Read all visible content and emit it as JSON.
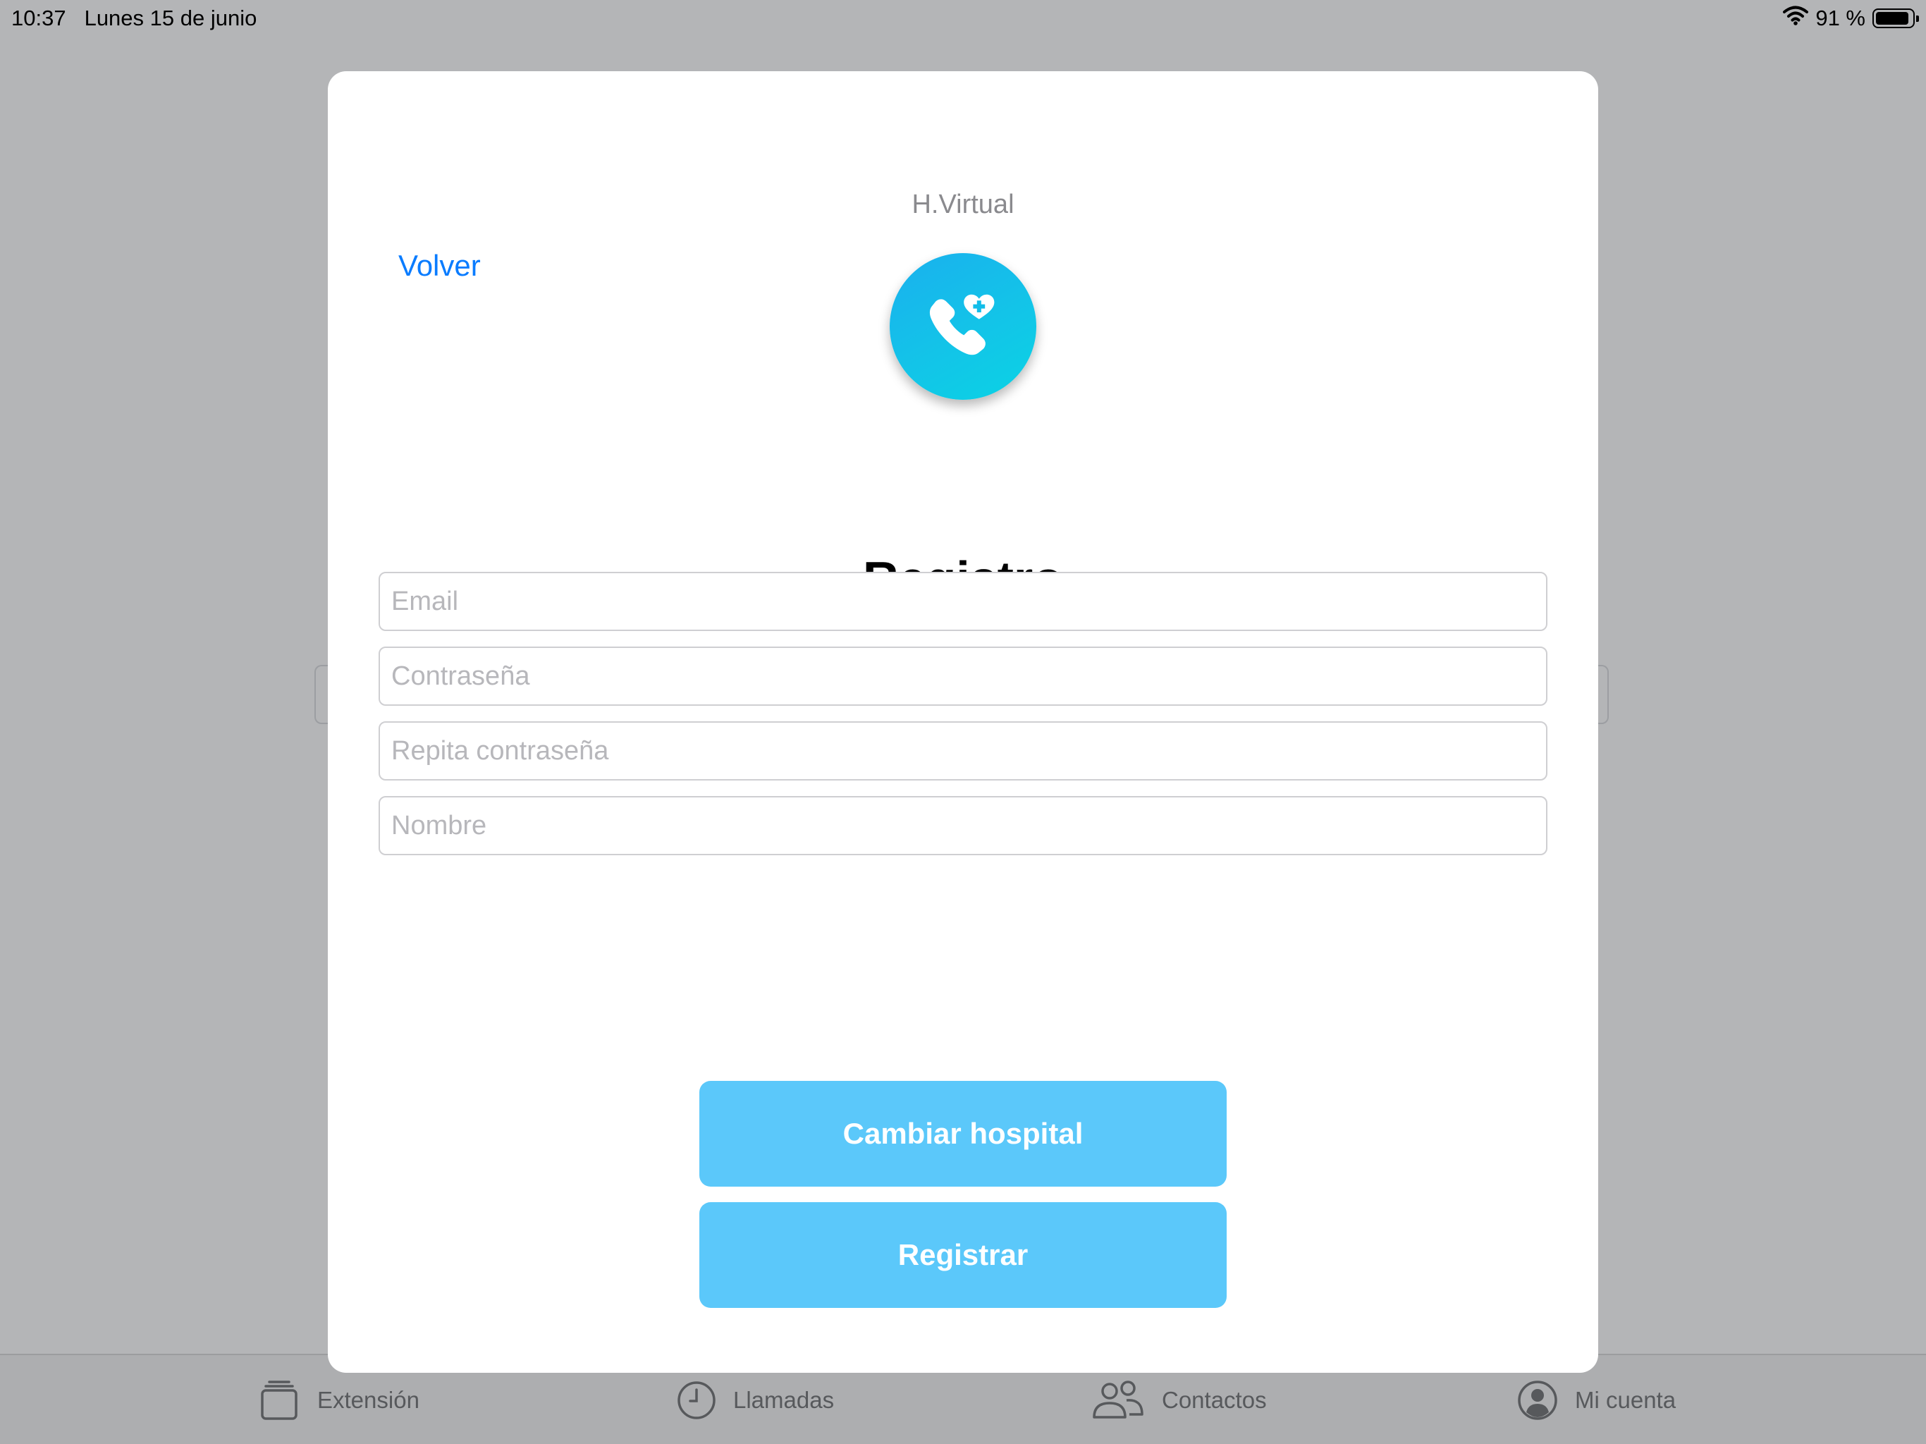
{
  "status_bar": {
    "time": "10:37",
    "date": "Lunes 15 de junio",
    "battery": "91 %",
    "battery_level": 0.91
  },
  "modal": {
    "title": "H.Virtual",
    "back_label": "Volver",
    "logo_icon": "phone-heart-icon",
    "heading": "Registro",
    "fields": {
      "email": {
        "value": "",
        "placeholder": "Email"
      },
      "password": {
        "value": "",
        "placeholder": "Contraseña"
      },
      "repeat_password": {
        "value": "",
        "placeholder": "Repita contraseña"
      },
      "name": {
        "value": "",
        "placeholder": "Nombre"
      }
    },
    "buttons": {
      "change_hospital": "Cambiar hospital",
      "register": "Registrar"
    }
  },
  "tab_bar": {
    "items": [
      {
        "label": "Extensión",
        "icon": "extension-cards-icon"
      },
      {
        "label": "Llamadas",
        "icon": "clock-icon"
      },
      {
        "label": "Contactos",
        "icon": "people-icon"
      },
      {
        "label": "Mi cuenta",
        "icon": "account-icon"
      }
    ]
  },
  "colors": {
    "accent_link": "#0a7cff",
    "button_fill": "#5bc8fa",
    "logo_gradient_start": "#1ab0ee",
    "logo_gradient_end": "#0ad3e4",
    "dim_background": "#b4b5b7"
  }
}
